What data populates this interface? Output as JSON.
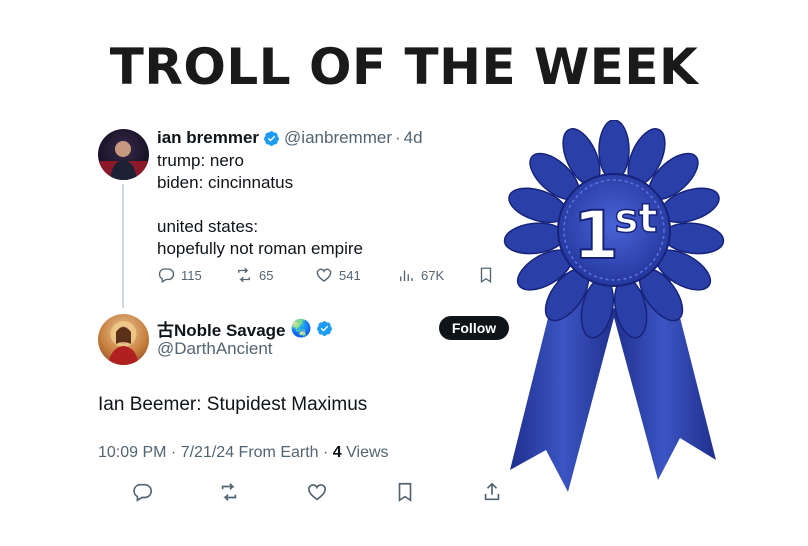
{
  "headline": "TROLL OF THE WEEK",
  "parent_tweet": {
    "name": "ian bremmer",
    "handle": "@ianbremmer",
    "age": "4d",
    "text": "trump: nero\nbiden: cincinnatus\n\nunited states:\nhopefully not roman empire",
    "replies": "115",
    "reposts": "65",
    "likes": "541",
    "views": "67K"
  },
  "reply_tweet": {
    "name": "古Noble Savage",
    "emoji": "🌏",
    "handle": "@DarthAncient",
    "follow_label": "Follow",
    "text": "Ian Beemer: Stupidest Maximus",
    "time": "10:09 PM",
    "date": "7/21/24",
    "source": "From Earth",
    "views_count": "4",
    "views_label": "Views"
  },
  "ribbon": {
    "label_number": "1",
    "label_suffix": "st",
    "color": "#2a3fa8"
  },
  "colors": {
    "verified": "#1d9bf0",
    "muted": "#536471",
    "text": "#0f1419"
  },
  "icons": [
    "verified-badge-icon",
    "reply-icon",
    "repost-icon",
    "like-icon",
    "views-icon",
    "bookmark-icon",
    "share-icon",
    "globe-emoji-icon"
  ]
}
